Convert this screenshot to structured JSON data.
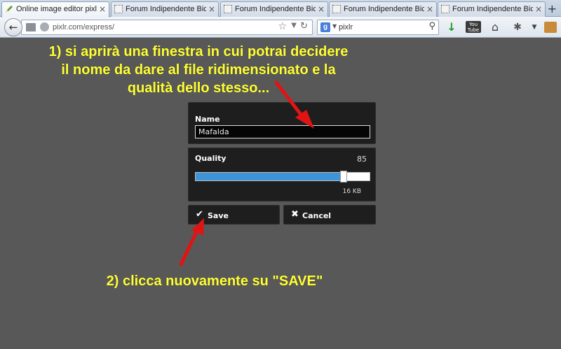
{
  "browser": {
    "tabs": [
      {
        "label": "Online image editor pixlr f...",
        "active": true
      },
      {
        "label": "Forum Indipendente Bicicl...",
        "active": false
      },
      {
        "label": "Forum Indipendente Bicicl...",
        "active": false
      },
      {
        "label": "Forum Indipendente Bicicl...",
        "active": false
      },
      {
        "label": "Forum Indipendente Bicicl...",
        "active": false
      }
    ],
    "close_glyph": "×",
    "new_tab_glyph": "+",
    "url": "pixlr.com/express/",
    "search_text": "pixlr",
    "search_engine_letter": "g",
    "youtube_label": "You Tube"
  },
  "annotations": {
    "step1_line1": "1) si aprirà una finestra in cui potrai decidere",
    "step1_line2": "il nome da dare al file ridimensionato e la",
    "step1_line3": "qualità dello stesso...",
    "step2": "2) clicca nuovamente su \"SAVE\""
  },
  "dialog": {
    "name_label": "Name",
    "name_value": "Mafalda",
    "quality_label": "Quality",
    "quality_value": "85",
    "quality_fraction": 0.85,
    "size_label": "16 KB",
    "save_label": "Save",
    "cancel_label": "Cancel"
  },
  "colors": {
    "annotation_text": "#ffff33",
    "arrow": "#e11414",
    "slider_fill": "#3e94d8",
    "background": "#585858"
  }
}
